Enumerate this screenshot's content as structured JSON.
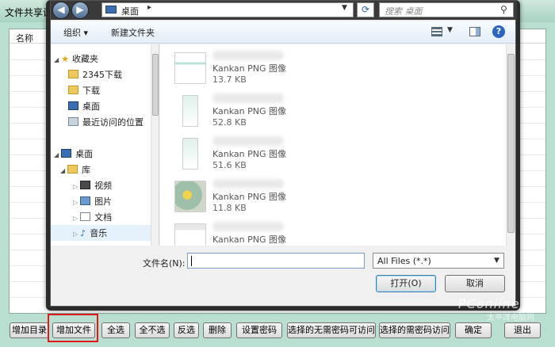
{
  "background_window": {
    "title": "文件共享设置",
    "column_name": "名称",
    "buttons": [
      "增加目录",
      "增加文件",
      "全选",
      "全不选",
      "反选",
      "删除",
      "设置密码",
      "选择的无需密码可访问",
      "选择的需密码访问",
      "确定",
      "退出"
    ]
  },
  "dialog": {
    "address": "桌面",
    "search_placeholder": "搜索 桌面",
    "toolbar": {
      "organize": "组织 ▾",
      "new_folder": "新建文件夹"
    },
    "nav": {
      "favorites": "收藏夹",
      "downloads_2345": "2345下载",
      "downloads": "下载",
      "desktop_fav": "桌面",
      "recent": "最近访问的位置",
      "desktop": "桌面",
      "library": "库",
      "videos": "视频",
      "pictures": "图片",
      "documents": "文档",
      "music": "音乐"
    },
    "files": [
      {
        "type": "Kankan PNG 图像",
        "size": "13.7 KB"
      },
      {
        "type": "Kankan PNG 图像",
        "size": "52.8 KB"
      },
      {
        "type": "Kankan PNG 图像",
        "size": "51.6 KB"
      },
      {
        "type": "Kankan PNG 图像",
        "size": "11.8 KB"
      },
      {
        "type": "Kankan PNG 图像",
        "size": ""
      }
    ],
    "filename_label": "文件名(N):",
    "filename_value": "",
    "filetype": "All Files (*.*)",
    "open_label": "打开(O)",
    "cancel_label": "取消"
  },
  "watermark": {
    "brand": "PConline",
    "sub": "太平洋电脑网"
  },
  "colors": {
    "highlight": "#e0191a",
    "bg_window": "#b8dfcf",
    "dialog_frame": "#2b2b2b"
  }
}
